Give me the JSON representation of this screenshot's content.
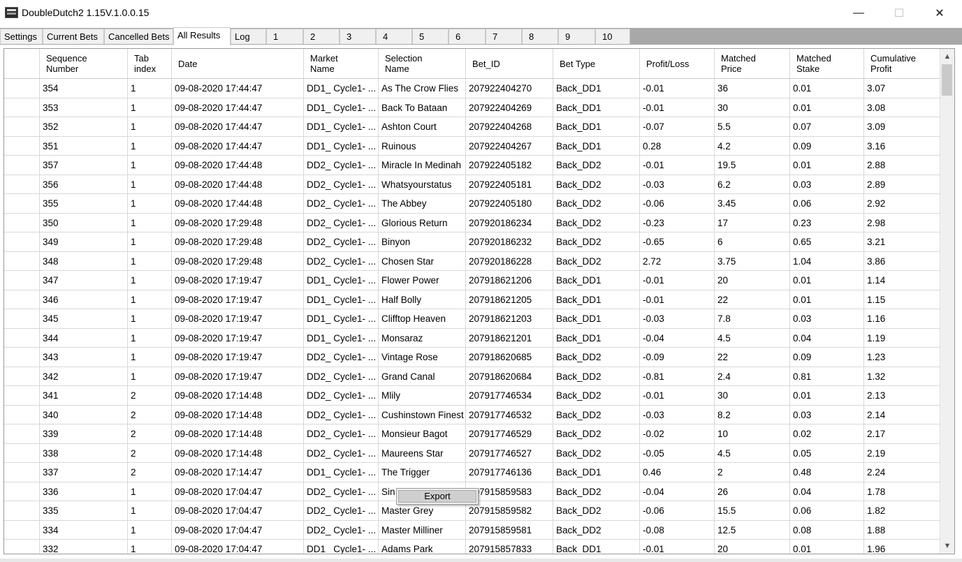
{
  "window": {
    "title": "DoubleDutch2 1.15V.1.0.0.15",
    "minimize_glyph": "—",
    "maximize_glyph": "☐",
    "close_glyph": "✕"
  },
  "tabs": [
    {
      "label": "Settings"
    },
    {
      "label": "Current Bets"
    },
    {
      "label": "Cancelled Bets"
    },
    {
      "label": "All Results",
      "active": true
    },
    {
      "label": "Log"
    },
    {
      "label": "1"
    },
    {
      "label": "2"
    },
    {
      "label": "3"
    },
    {
      "label": "4"
    },
    {
      "label": "5"
    },
    {
      "label": "6"
    },
    {
      "label": "7"
    },
    {
      "label": "8"
    },
    {
      "label": "9"
    },
    {
      "label": "10"
    }
  ],
  "grid": {
    "columns": [
      "",
      "Sequence\nNumber",
      "Tab\nindex",
      "Date",
      "Market\nName",
      "Selection\nName",
      "Bet_ID",
      "Bet Type",
      "Profit/Loss",
      "Matched\nPrice",
      "Matched\nStake",
      "Cumulative\nProfit"
    ],
    "rows": [
      [
        "354",
        "1",
        "09-08-2020 17:44:47",
        "DD1_ Cycle1- ...",
        "As The Crow Flies",
        "207922404270",
        "Back_DD1",
        "-0.01",
        "36",
        "0.01",
        "3.07"
      ],
      [
        "353",
        "1",
        "09-08-2020 17:44:47",
        "DD1_ Cycle1- ...",
        "Back To Bataan",
        "207922404269",
        "Back_DD1",
        "-0.01",
        "30",
        "0.01",
        "3.08"
      ],
      [
        "352",
        "1",
        "09-08-2020 17:44:47",
        "DD1_ Cycle1- ...",
        "Ashton Court",
        "207922404268",
        "Back_DD1",
        "-0.07",
        "5.5",
        "0.07",
        "3.09"
      ],
      [
        "351",
        "1",
        "09-08-2020 17:44:47",
        "DD1_ Cycle1- ...",
        "Ruinous",
        "207922404267",
        "Back_DD1",
        "0.28",
        "4.2",
        "0.09",
        "3.16"
      ],
      [
        "357",
        "1",
        "09-08-2020 17:44:48",
        "DD2_ Cycle1- ...",
        "Miracle In Medinah",
        "207922405182",
        "Back_DD2",
        "-0.01",
        "19.5",
        "0.01",
        "2.88"
      ],
      [
        "356",
        "1",
        "09-08-2020 17:44:48",
        "DD2_ Cycle1- ...",
        "Whatsyourstatus",
        "207922405181",
        "Back_DD2",
        "-0.03",
        "6.2",
        "0.03",
        "2.89"
      ],
      [
        "355",
        "1",
        "09-08-2020 17:44:48",
        "DD2_ Cycle1- ...",
        "The Abbey",
        "207922405180",
        "Back_DD2",
        "-0.06",
        "3.45",
        "0.06",
        "2.92"
      ],
      [
        "350",
        "1",
        "09-08-2020 17:29:48",
        "DD2_ Cycle1- ...",
        "Glorious Return",
        "207920186234",
        "Back_DD2",
        "-0.23",
        "17",
        "0.23",
        "2.98"
      ],
      [
        "349",
        "1",
        "09-08-2020 17:29:48",
        "DD2_ Cycle1- ...",
        "Binyon",
        "207920186232",
        "Back_DD2",
        "-0.65",
        "6",
        "0.65",
        "3.21"
      ],
      [
        "348",
        "1",
        "09-08-2020 17:29:48",
        "DD2_ Cycle1- ...",
        "Chosen Star",
        "207920186228",
        "Back_DD2",
        "2.72",
        "3.75",
        "1.04",
        "3.86"
      ],
      [
        "347",
        "1",
        "09-08-2020 17:19:47",
        "DD1_ Cycle1- ...",
        "Flower Power",
        "207918621206",
        "Back_DD1",
        "-0.01",
        "20",
        "0.01",
        "1.14"
      ],
      [
        "346",
        "1",
        "09-08-2020 17:19:47",
        "DD1_ Cycle1- ...",
        "Half Bolly",
        "207918621205",
        "Back_DD1",
        "-0.01",
        "22",
        "0.01",
        "1.15"
      ],
      [
        "345",
        "1",
        "09-08-2020 17:19:47",
        "DD1_ Cycle1- ...",
        "Clifftop Heaven",
        "207918621203",
        "Back_DD1",
        "-0.03",
        "7.8",
        "0.03",
        "1.16"
      ],
      [
        "344",
        "1",
        "09-08-2020 17:19:47",
        "DD1_ Cycle1- ...",
        "Monsaraz",
        "207918621201",
        "Back_DD1",
        "-0.04",
        "4.5",
        "0.04",
        "1.19"
      ],
      [
        "343",
        "1",
        "09-08-2020 17:19:47",
        "DD2_ Cycle1- ...",
        "Vintage Rose",
        "207918620685",
        "Back_DD2",
        "-0.09",
        "22",
        "0.09",
        "1.23"
      ],
      [
        "342",
        "1",
        "09-08-2020 17:19:47",
        "DD2_ Cycle1- ...",
        "Grand Canal",
        "207918620684",
        "Back_DD2",
        "-0.81",
        "2.4",
        "0.81",
        "1.32"
      ],
      [
        "341",
        "2",
        "09-08-2020 17:14:48",
        "DD2_ Cycle1- ...",
        "Mlily",
        "207917746534",
        "Back_DD2",
        "-0.01",
        "30",
        "0.01",
        "2.13"
      ],
      [
        "340",
        "2",
        "09-08-2020 17:14:48",
        "DD2_ Cycle1- ...",
        "Cushinstown Finest",
        "207917746532",
        "Back_DD2",
        "-0.03",
        "8.2",
        "0.03",
        "2.14"
      ],
      [
        "339",
        "2",
        "09-08-2020 17:14:48",
        "DD2_ Cycle1- ...",
        "Monsieur Bagot",
        "207917746529",
        "Back_DD2",
        "-0.02",
        "10",
        "0.02",
        "2.17"
      ],
      [
        "338",
        "2",
        "09-08-2020 17:14:48",
        "DD2_ Cycle1- ...",
        "Maureens Star",
        "207917746527",
        "Back_DD2",
        "-0.05",
        "4.5",
        "0.05",
        "2.19"
      ],
      [
        "337",
        "2",
        "09-08-2020 17:14:47",
        "DD1_ Cycle1- ...",
        "The Trigger",
        "207917746136",
        "Back_DD1",
        "0.46",
        "2",
        "0.48",
        "2.24"
      ],
      [
        "336",
        "1",
        "09-08-2020 17:04:47",
        "DD2_ Cycle1- ...",
        "Sin",
        "207915859583",
        "Back_DD2",
        "-0.04",
        "26",
        "0.04",
        "1.78"
      ],
      [
        "335",
        "1",
        "09-08-2020 17:04:47",
        "DD2_ Cycle1- ...",
        "Master Grey",
        "207915859582",
        "Back_DD2",
        "-0.06",
        "15.5",
        "0.06",
        "1.82"
      ],
      [
        "334",
        "1",
        "09-08-2020 17:04:47",
        "DD2_ Cycle1- ...",
        "Master Milliner",
        "207915859581",
        "Back_DD2",
        "-0.08",
        "12.5",
        "0.08",
        "1.88"
      ],
      [
        "332",
        "1",
        "09-08-2020 17:04:47",
        "DD1_ Cycle1- ...",
        "Adams Park",
        "207915857833",
        "Back_DD1",
        "-0.01",
        "20",
        "0.01",
        "1.96"
      ]
    ]
  },
  "context_menu": {
    "items": [
      "Export"
    ]
  },
  "scrollbar": {
    "up_glyph": "▲",
    "down_glyph": "▼"
  }
}
